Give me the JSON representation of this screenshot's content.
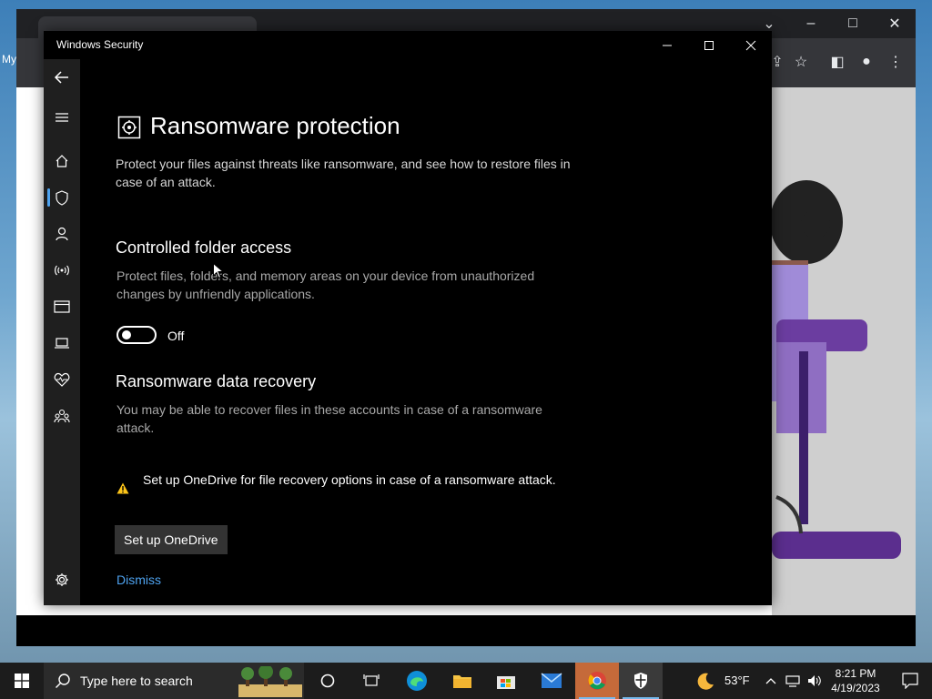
{
  "app": {
    "window_title": "Windows Security",
    "page_title": "Ransomware protection",
    "page_description": "Protect your files against threats like ransomware, and see how to restore files in case of an attack."
  },
  "controlled_folder_access": {
    "heading": "Controlled folder access",
    "description": "Protect files, folders, and memory areas on your device from unauthorized changes by unfriendly applications.",
    "toggle_state": "Off"
  },
  "data_recovery": {
    "heading": "Ransomware data recovery",
    "description": "You may be able to recover files in these accounts in case of a ransomware attack.",
    "warning_text": "Set up OneDrive for file recovery options in case of a ransomware attack.",
    "setup_button": "Set up OneDrive",
    "dismiss_link": "Dismiss"
  },
  "nav": {
    "items": [
      {
        "icon": "back-arrow-icon"
      },
      {
        "icon": "hamburger-menu-icon"
      },
      {
        "icon": "home-icon"
      },
      {
        "icon": "shield-icon",
        "selected": true
      },
      {
        "icon": "person-icon"
      },
      {
        "icon": "wifi-antenna-icon"
      },
      {
        "icon": "app-browser-icon"
      },
      {
        "icon": "laptop-icon"
      },
      {
        "icon": "heart-pulse-icon"
      },
      {
        "icon": "family-icon"
      },
      {
        "icon": "gear-icon"
      }
    ]
  },
  "taskbar": {
    "search_placeholder": "Type here to search",
    "weather_temp": "53°F",
    "time": "8:21 PM",
    "date": "4/19/2023"
  },
  "background": {
    "desktop_label": "My"
  },
  "colors": {
    "accent": "#4ea3f0",
    "warning": "#fcc419",
    "window_bg": "#000000",
    "nav_bg": "#1f1f1f"
  }
}
